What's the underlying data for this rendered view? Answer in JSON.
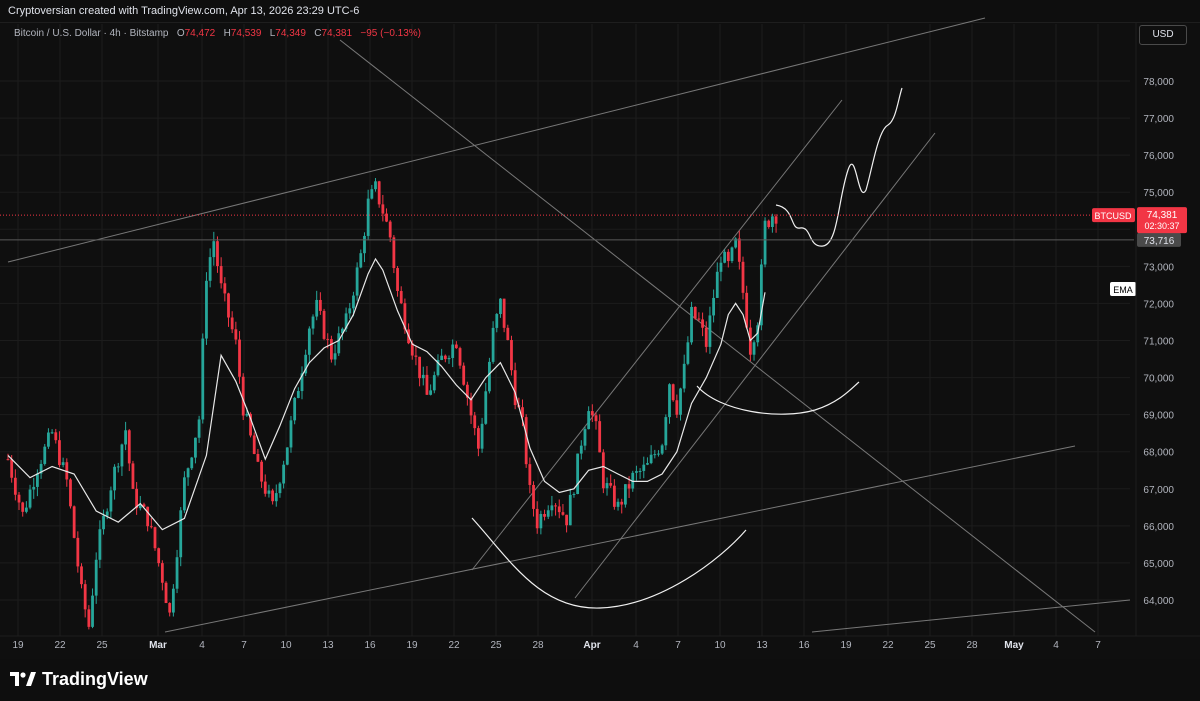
{
  "header": {
    "created_by": "Cryptoversian created with TradingView.com, Apr 13, 2026 23:29 UTC-6"
  },
  "legend": {
    "symbol": "Bitcoin / U.S. Dollar · 4h · Bitstamp",
    "o_label": "O",
    "o_value": "74,472",
    "h_label": "H",
    "h_value": "74,539",
    "l_label": "L",
    "l_value": "74,349",
    "c_label": "C",
    "c_value": "74,381",
    "change": "−95 (−0.13%)"
  },
  "currency_button": "USD",
  "footer": {
    "brand": "TradingView"
  },
  "colors": {
    "up": "#26a69a",
    "down": "#f23645",
    "ema": "#e8e8e8",
    "drawing": "#8a8a8a",
    "price_tag": "#f23645"
  },
  "chart_data": {
    "type": "candlestick",
    "symbol": "BTCUSD",
    "interval": "4h",
    "exchange": "Bitstamp",
    "ylim": [
      63000,
      79000
    ],
    "y_ticks": [
      "64,000",
      "65,000",
      "66,000",
      "67,000",
      "68,000",
      "69,000",
      "70,000",
      "71,000",
      "72,000",
      "73,000",
      "74,000",
      "75,000",
      "76,000",
      "77,000",
      "78,000"
    ],
    "x_ticks": [
      "19",
      "22",
      "25",
      "Mar",
      "4",
      "7",
      "10",
      "13",
      "16",
      "19",
      "22",
      "25",
      "28",
      "Apr",
      "4",
      "7",
      "10",
      "13",
      "16",
      "19",
      "22",
      "25",
      "28",
      "May",
      "4",
      "7"
    ],
    "current_price": {
      "label": "BTCUSD",
      "value": "74,381",
      "countdown": "02:30:37",
      "price": 74381
    },
    "horizontal_level": {
      "value": "73,716",
      "price": 73716
    },
    "ema_label": "EMA",
    "price_path": [
      [
        0,
        67800
      ],
      [
        2,
        66300
      ],
      [
        4,
        67600
      ],
      [
        6,
        68500
      ],
      [
        8,
        67200
      ],
      [
        10,
        64200
      ],
      [
        11,
        63300
      ],
      [
        12,
        65200
      ],
      [
        14,
        67100
      ],
      [
        16,
        68600
      ],
      [
        17,
        66800
      ],
      [
        19,
        66200
      ],
      [
        21,
        64600
      ],
      [
        22,
        63600
      ],
      [
        24,
        67200
      ],
      [
        26,
        68900
      ],
      [
        27,
        72800
      ],
      [
        28,
        73700
      ],
      [
        29,
        72400
      ],
      [
        31,
        70900
      ],
      [
        32,
        69200
      ],
      [
        34,
        67500
      ],
      [
        36,
        66500
      ],
      [
        38,
        68200
      ],
      [
        40,
        70300
      ],
      [
        41,
        71400
      ],
      [
        42,
        71900
      ],
      [
        44,
        70600
      ],
      [
        46,
        71500
      ],
      [
        48,
        73300
      ],
      [
        49,
        74700
      ],
      [
        50,
        75100
      ],
      [
        51,
        74500
      ],
      [
        52,
        73800
      ],
      [
        53,
        72300
      ],
      [
        55,
        70800
      ],
      [
        57,
        69500
      ],
      [
        59,
        70500
      ],
      [
        61,
        71000
      ],
      [
        63,
        69000
      ],
      [
        64,
        68100
      ],
      [
        66,
        71200
      ],
      [
        67,
        72000
      ],
      [
        68,
        70900
      ],
      [
        69,
        69500
      ],
      [
        70,
        68700
      ],
      [
        71,
        66900
      ],
      [
        72,
        66100
      ],
      [
        74,
        66800
      ],
      [
        76,
        66200
      ],
      [
        77,
        67100
      ],
      [
        78,
        68300
      ],
      [
        79,
        69300
      ],
      [
        80,
        68600
      ],
      [
        81,
        67200
      ],
      [
        83,
        66500
      ],
      [
        85,
        67300
      ],
      [
        87,
        67600
      ],
      [
        89,
        68300
      ],
      [
        90,
        69900
      ],
      [
        91,
        69200
      ],
      [
        92,
        70200
      ],
      [
        93,
        71700
      ],
      [
        94,
        71500
      ],
      [
        95,
        70900
      ],
      [
        96,
        72200
      ],
      [
        97,
        73300
      ],
      [
        98,
        73000
      ],
      [
        99,
        73600
      ],
      [
        100,
        72300
      ],
      [
        101,
        70800
      ],
      [
        102,
        71600
      ],
      [
        103,
        74100
      ],
      [
        104,
        74400
      ]
    ],
    "ema_path": [
      [
        0,
        67900
      ],
      [
        3,
        67300
      ],
      [
        6,
        67600
      ],
      [
        9,
        67400
      ],
      [
        12,
        66400
      ],
      [
        15,
        66100
      ],
      [
        18,
        66600
      ],
      [
        21,
        65900
      ],
      [
        24,
        66200
      ],
      [
        27,
        67900
      ],
      [
        29,
        70600
      ],
      [
        31,
        69900
      ],
      [
        33,
        68900
      ],
      [
        35,
        67800
      ],
      [
        37,
        68700
      ],
      [
        39,
        69700
      ],
      [
        41,
        70400
      ],
      [
        43,
        70800
      ],
      [
        45,
        71000
      ],
      [
        47,
        71700
      ],
      [
        49,
        72800
      ],
      [
        50,
        73200
      ],
      [
        51,
        72900
      ],
      [
        53,
        71800
      ],
      [
        55,
        70900
      ],
      [
        57,
        70700
      ],
      [
        59,
        70300
      ],
      [
        61,
        69800
      ],
      [
        63,
        69400
      ],
      [
        65,
        70000
      ],
      [
        67,
        70400
      ],
      [
        69,
        69600
      ],
      [
        71,
        68100
      ],
      [
        73,
        67200
      ],
      [
        75,
        66900
      ],
      [
        77,
        67000
      ],
      [
        79,
        67500
      ],
      [
        81,
        67600
      ],
      [
        83,
        67400
      ],
      [
        85,
        67200
      ],
      [
        87,
        67200
      ],
      [
        89,
        67400
      ],
      [
        91,
        68000
      ],
      [
        93,
        69300
      ],
      [
        95,
        70000
      ],
      [
        97,
        70900
      ],
      [
        98,
        71700
      ],
      [
        99,
        72000
      ],
      [
        100,
        71700
      ],
      [
        101,
        71000
      ],
      [
        102,
        71200
      ],
      [
        103,
        72300
      ]
    ]
  }
}
